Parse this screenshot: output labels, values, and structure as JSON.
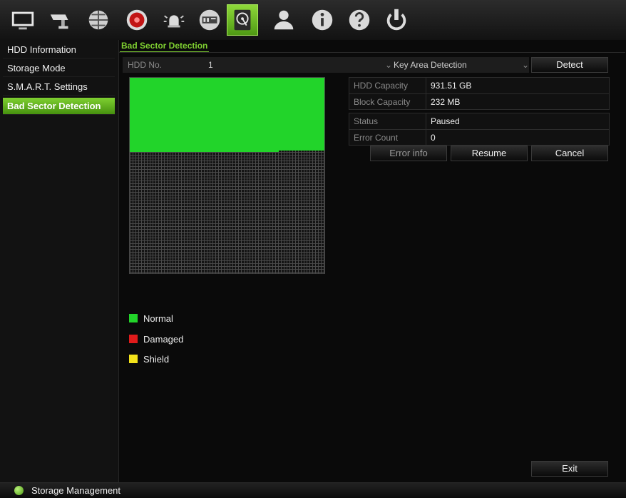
{
  "toolbar": {
    "icons": [
      "display-icon",
      "camera-icon",
      "network-icon",
      "record-icon",
      "alarm-icon",
      "device-icon",
      "hdd-icon",
      "user-icon",
      "info-icon",
      "help-icon",
      "power-icon"
    ],
    "active": "hdd-icon"
  },
  "sidebar": {
    "items": [
      {
        "label": "HDD Information"
      },
      {
        "label": "Storage Mode"
      },
      {
        "label": "S.M.A.R.T. Settings"
      },
      {
        "label": "Bad Sector Detection"
      }
    ],
    "active_index": 3
  },
  "main": {
    "tab_label": "Bad Sector Detection",
    "hdd_no_label": "HDD No.",
    "hdd_no_value": "1",
    "mode_value": "Key Area Detection",
    "detect_button": "Detect",
    "info": {
      "hdd_capacity_label": "HDD Capacity",
      "hdd_capacity_value": "931.51 GB",
      "block_capacity_label": "Block Capacity",
      "block_capacity_value": "232 MB",
      "status_label": "Status",
      "status_value": "Paused",
      "error_count_label": "Error Count",
      "error_count_value": "0"
    },
    "buttons": {
      "error_info": "Error info",
      "resume": "Resume",
      "cancel": "Cancel",
      "exit": "Exit"
    },
    "legend": [
      {
        "label": "Normal",
        "color": "#22d42a"
      },
      {
        "label": "Damaged",
        "color": "#e01b1b"
      },
      {
        "label": "Shield",
        "color": "#f2e21a"
      }
    ]
  },
  "status_bar": {
    "text": "Storage Management"
  },
  "colors": {
    "accent": "#7fd031",
    "normal": "#22d42a",
    "damaged": "#e01b1b",
    "shield": "#f2e21a"
  }
}
